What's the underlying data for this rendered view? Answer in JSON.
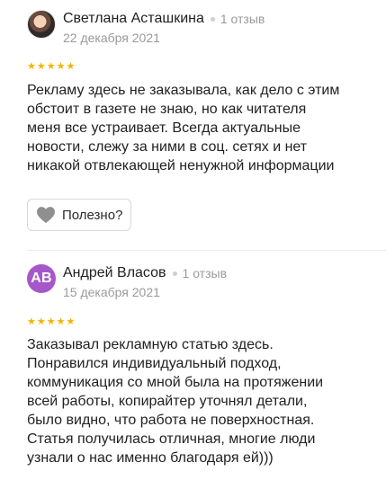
{
  "reviews": [
    {
      "author": "Светлана Асташкина",
      "reviews_count": "1 отзыв",
      "date": "22 декабря 2021",
      "rating": 5,
      "text": "Рекламу здесь не заказывала, как дело с этим\nобстоит в газете не знаю, но как читателя\nменя все устраивает. Всегда актуальные\nновости, слежу за ними в соц. сетях и нет\nникакой отвлекающей ненужной информации",
      "helpful_label": "Полезно?"
    },
    {
      "author": "Андрей Власов",
      "avatar_initials": "АВ",
      "reviews_count": "1 отзыв",
      "date": "15 декабря 2021",
      "rating": 5,
      "text": "Заказывал рекламную статью здесь.\nПонравился индивидуальный подход,\nкоммуникация со мной была на протяжении\nвсей работы, копирайтер уточнял детали,\nбыло видно, что работа не поверхностная.\nСтатья получилась отличная, многие люди\nузнали о нас именно благодаря ей)))"
    }
  ],
  "colors": {
    "star": "#f4b400",
    "avatar_bg": "#a657c9",
    "muted_text": "#9a9a9a"
  },
  "icons": [
    "heart-icon",
    "star-icon"
  ]
}
